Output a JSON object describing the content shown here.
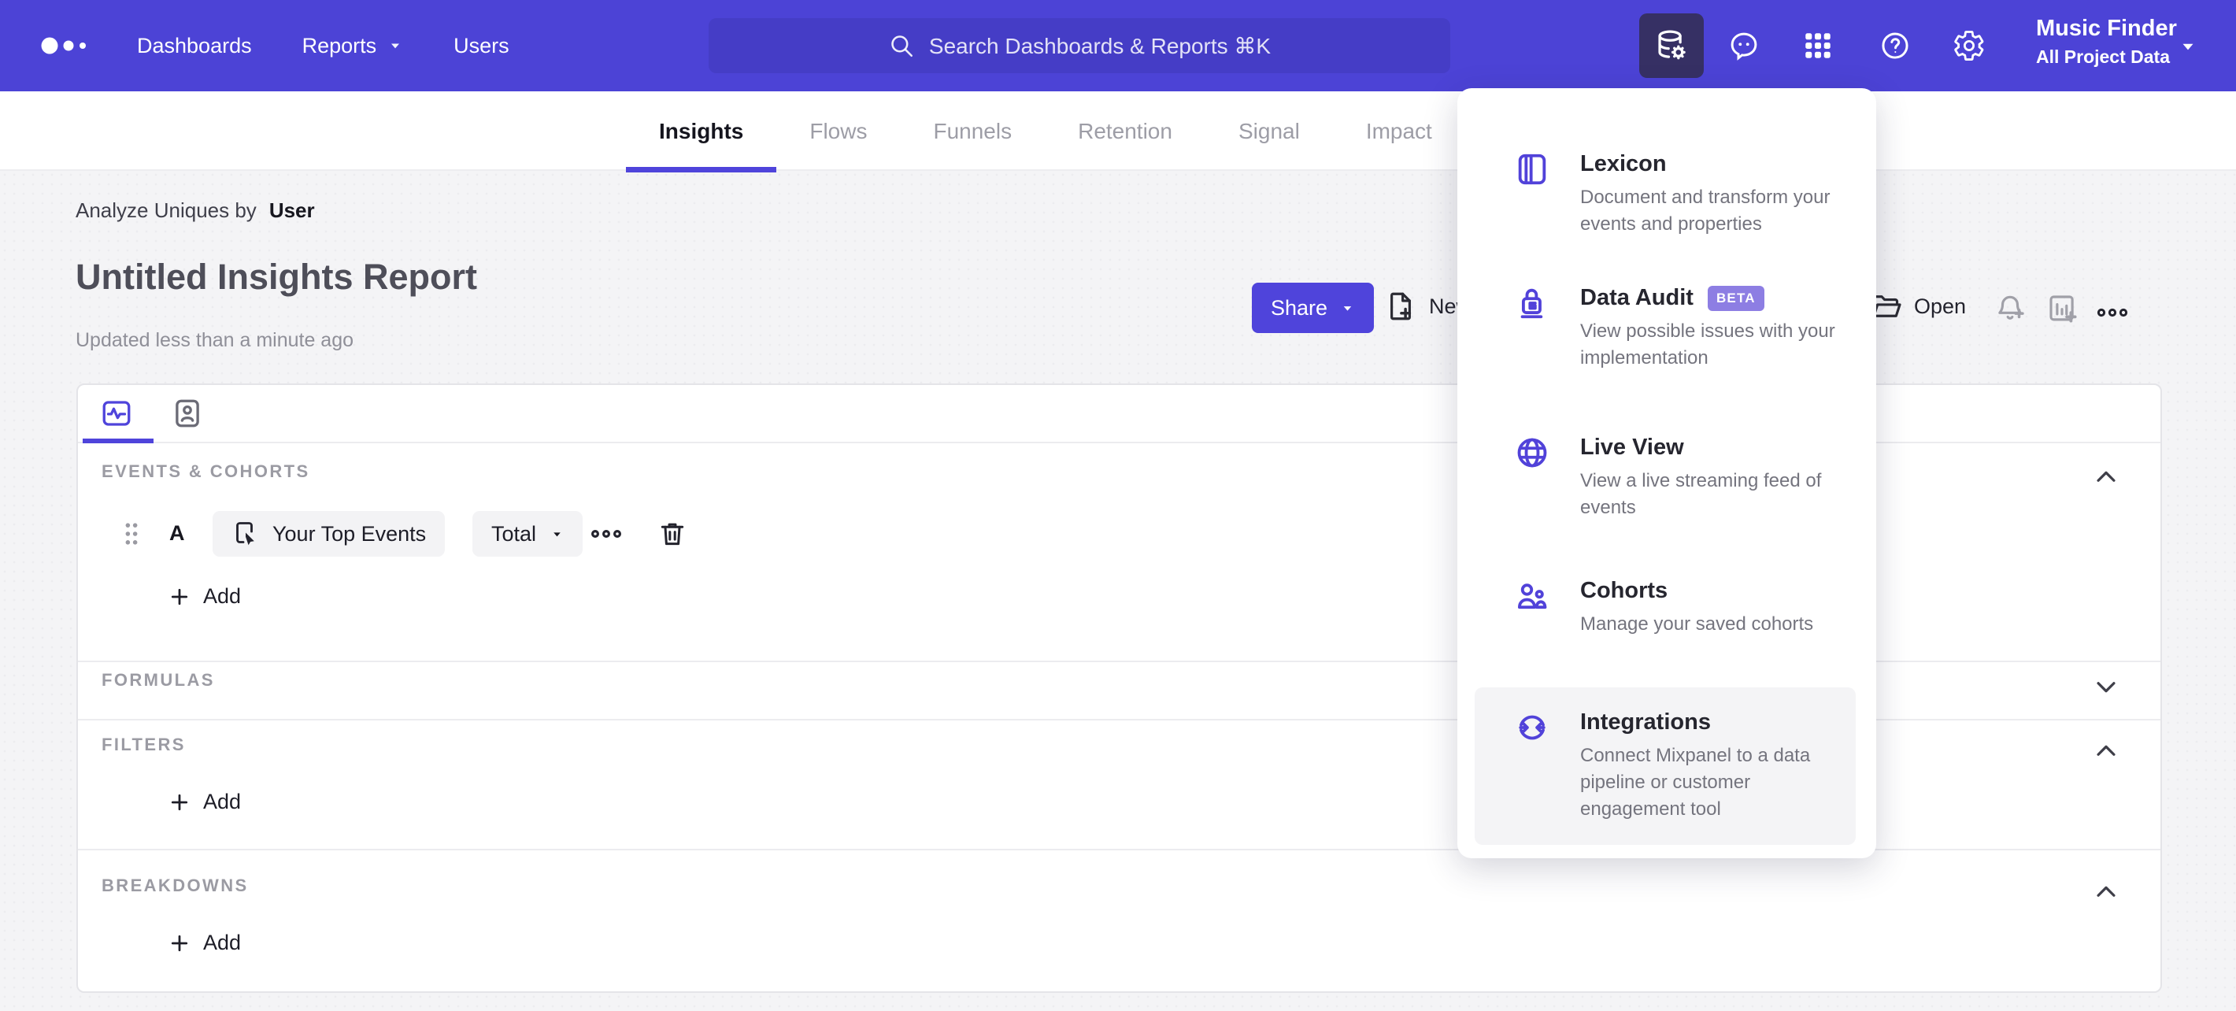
{
  "colors": {
    "header_bg": "#4c43d6",
    "accent": "#4f44db",
    "search_bg": "#453dc6",
    "active_tile_bg": "#363064",
    "beta_badge_bg": "#8d7ee3",
    "page_bg": "#f4f4f6"
  },
  "icons": {
    "logo": "three-dots",
    "search": "magnifier",
    "data_settings": "database-gear",
    "feedback": "speech-bubble",
    "apps": "grid-3x3",
    "help": "question-circle",
    "settings": "gear",
    "event": "card-cursor",
    "delete": "trash",
    "more": "kebab-horizontal"
  },
  "header": {
    "nav": [
      {
        "label": "Dashboards"
      },
      {
        "label": "Reports"
      },
      {
        "label": "Users"
      }
    ],
    "search": {
      "placeholder": "Search Dashboards & Reports ⌘K"
    },
    "project": {
      "name": "Music Finder",
      "scope": "All Project Data"
    }
  },
  "tabs": [
    {
      "label": "Insights",
      "active": true
    },
    {
      "label": "Flows",
      "active": false
    },
    {
      "label": "Funnels",
      "active": false
    },
    {
      "label": "Retention",
      "active": false
    },
    {
      "label": "Signal",
      "active": false
    },
    {
      "label": "Impact",
      "active": false
    }
  ],
  "report": {
    "analyze_prefix": "Analyze Uniques by",
    "analyze_value": "User",
    "title": "Untitled Insights Report",
    "updated": "Updated less than a minute ago"
  },
  "toolbar": {
    "share_label": "Share",
    "new_label": "New",
    "open_label": "Open"
  },
  "builder": {
    "sections": {
      "events": {
        "label": "EVENTS & COHORTS",
        "collapsed": false
      },
      "formulas": {
        "label": "FORMULAS",
        "collapsed": true
      },
      "filters": {
        "label": "FILTERS",
        "collapsed": false
      },
      "breakdowns": {
        "label": "BREAKDOWNS",
        "collapsed": false
      }
    },
    "event_row": {
      "letter": "A",
      "event_label": "Your Top Events",
      "metric_label": "Total"
    },
    "add_label": "Add"
  },
  "menu": {
    "items": [
      {
        "title": "Lexicon",
        "description": "Document and transform your events and properties"
      },
      {
        "title": "Data Audit",
        "badge": "BETA",
        "description": "View possible issues with your implementation"
      },
      {
        "title": "Live View",
        "description": "View a live streaming feed of events"
      },
      {
        "title": "Cohorts",
        "description": "Manage your saved cohorts"
      },
      {
        "title": "Integrations",
        "description": "Connect Mixpanel to a data pipeline or customer engagement tool",
        "highlighted": true
      }
    ]
  }
}
